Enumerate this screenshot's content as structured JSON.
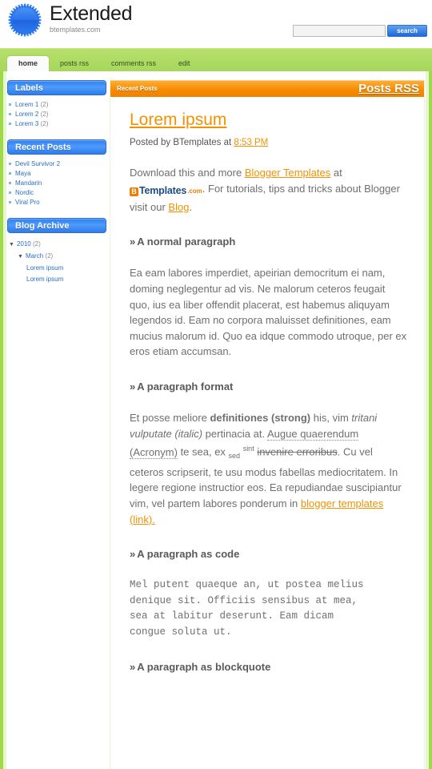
{
  "header": {
    "logo_icon": "starburst-logo",
    "site_title": "Extended",
    "site_description": "btemplates.com"
  },
  "search": {
    "value": "",
    "placeholder": "",
    "button_label": "search"
  },
  "nav": {
    "items": [
      {
        "label": "home",
        "active": true
      },
      {
        "label": "posts rss",
        "active": false
      },
      {
        "label": "comments rss",
        "active": false
      },
      {
        "label": "edit",
        "active": false
      }
    ]
  },
  "sidebar": {
    "widgets": [
      {
        "title": "Labels",
        "items": [
          {
            "label": "Lorem 1",
            "count": "(2)"
          },
          {
            "label": "Lorem 2",
            "count": "(2)"
          },
          {
            "label": "Lorem 3",
            "count": "(2)"
          }
        ]
      },
      {
        "title": "Recent Posts",
        "items": [
          {
            "label": "Devil Survivor 2",
            "count": ""
          },
          {
            "label": "Maya",
            "count": ""
          },
          {
            "label": "Mandarin",
            "count": ""
          },
          {
            "label": "Nordic",
            "count": ""
          },
          {
            "label": "Viral Pro",
            "count": ""
          }
        ]
      }
    ],
    "archive": {
      "title": "Blog Archive",
      "year_label": "2010",
      "year_count": "(2)",
      "month_label": "March",
      "month_count": "(2)",
      "entries": [
        "Lorem ipsum",
        "Lorem ipsum"
      ],
      "toggle_glyph": "▼"
    }
  },
  "main": {
    "bar_title": "Recent Posts",
    "posts_rss_label": "Posts RSS",
    "post": {
      "title": "Lorem ipsum",
      "meta_prefix": "Posted by BTemplates at",
      "time": "8:53 PM",
      "intro": {
        "part1": "Download this and more ",
        "link1": "Blogger Templates",
        "part2": " at ",
        "logo_b": "B",
        "logo_name": "Templates",
        "logo_com": ".com",
        "part3": ". For tutorials, tips and tricks about Blogger visit our ",
        "link2": "Blog",
        "part4": "."
      },
      "sections": [
        {
          "heading": "A normal paragraph",
          "text": "Ea eam labores imperdiet, apeirian democritum ei nam, doming neglegentur ad vis. Ne malorum ceteros feugait quo, ius ea liber offendit placerat, est habemus aliquyam legendos id. Eam no corpora maluisset definitiones, eam mucius malorum id. Quo ea idque commodo utroque, per ex eros etiam accumsan."
        },
        {
          "heading": "A paragraph format",
          "format": {
            "t1": "Et posse meliore ",
            "strong": "definitiones (strong)",
            "t2": " his, vim ",
            "italic": "tritani vulputate (italic)",
            "t3": " pertinacia at. ",
            "acronym": "Augue quaerendum (Acronym)",
            "t4": " te sea, ex ",
            "sub": "sed",
            "t5": " ",
            "sup": "sint",
            "t6": " ",
            "strike": "invenire erroribus",
            "t7": ". Cu vel ceteros scripserit, te usu modus fabellas mediocritatem. In legere regione instructior eos. Ea repudiandae suscipiantur vim, vel partem labores ponderum in ",
            "link": "blogger templates (link).",
            "t8": ""
          }
        },
        {
          "heading": "A paragraph as code",
          "code": "Mel putent quaeque an, ut postea melius\ndenique sit. Officiis sensibus at mea,\nsea at labitur deserunt. Eam dicam\ncongue soluta ut."
        },
        {
          "heading": "A paragraph as blockquote"
        }
      ],
      "heading_prefix": "»"
    }
  },
  "colors": {
    "green_border": "#9ed94a",
    "nav_green": "#b6e06a",
    "widget_blue": "#2f7ff0",
    "accent_orange": "#f29200",
    "bar_orange": "#f58a00"
  }
}
